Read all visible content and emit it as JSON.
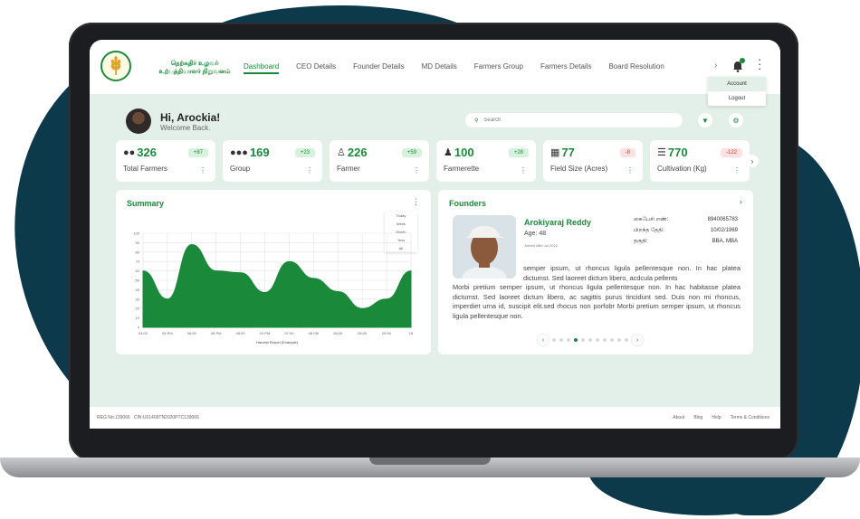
{
  "brand": {
    "line1": "நெற்கதிர் உழவர்",
    "line2": "உற்பத்தியாளர் நிறுவனம்"
  },
  "nav": {
    "items": [
      "Dashboard",
      "CEO Details",
      "Founder Details",
      "MD Details",
      "Farmers Group",
      "Farmers Details",
      "Board Resolution"
    ],
    "more": "›"
  },
  "menu": {
    "items": [
      "Account",
      "Logout"
    ]
  },
  "greeting": {
    "hi": "Hi, Arockia!",
    "welcome": "Welcome Back."
  },
  "search": {
    "placeholder": "Search"
  },
  "stats": [
    {
      "value": "326",
      "badge": "+87",
      "label": "Total Farmers",
      "trend": "up",
      "icon": "users-icon"
    },
    {
      "value": "169",
      "badge": "+23",
      "label": "Group",
      "trend": "up",
      "icon": "group-icon"
    },
    {
      "value": "226",
      "badge": "+59",
      "label": "Farmer",
      "trend": "up",
      "icon": "farmer-icon"
    },
    {
      "value": "100",
      "badge": "+28",
      "label": "Farmerette",
      "trend": "up",
      "icon": "farmerette-icon"
    },
    {
      "value": "77",
      "badge": "-8",
      "label": "Field Size (Acres)",
      "trend": "down",
      "icon": "field-icon"
    },
    {
      "value": "770",
      "badge": "-122",
      "label": "Cultivation (Kg)",
      "trend": "down",
      "icon": "cultivation-icon"
    }
  ],
  "summary": {
    "title": "Summary",
    "filter_options": [
      "Today",
      "Week",
      "Month",
      "Year",
      "All"
    ]
  },
  "chart_data": {
    "type": "area",
    "x": [
      "04:00",
      "05 PM",
      "06:00",
      "08 PM",
      "06:00",
      "10 PM",
      "07:00",
      "08 PM",
      "06:00",
      "08:00",
      "09:00",
      "18"
    ],
    "values": [
      60,
      30,
      88,
      60,
      58,
      37,
      70,
      52,
      38,
      20,
      30,
      60
    ],
    "xlabel": "Harvest Report (Example)",
    "ylim": [
      0,
      100
    ],
    "yticks": [
      0,
      10,
      20,
      30,
      40,
      50,
      60,
      70,
      80,
      90,
      100
    ],
    "color": "#1a8a3a",
    "grid": true
  },
  "founders": {
    "title": "Founders",
    "name": "Arokiyaraj Reddy",
    "age": "Age: 48",
    "joined": "Joined 28th Jul 2022",
    "details": [
      {
        "label": "கைபேசி எண்:",
        "value": "8940065783"
      },
      {
        "label": "பிறந்த தேதி:",
        "value": "10/02/1969"
      },
      {
        "label": "தகுதி:",
        "value": "BBA, MBA"
      }
    ],
    "body1": "semper ipsum, ut rhoncus ligula pellentesque non. In hac platea dictumst. Sed laoreet dictum libero, acdcula pellents",
    "body2": "Morbi pretium semper ipsum, ut rhoncus ligula pellentesque non. In hac habitasse platea dictumst. Sed laoreet dictum libero, ac sagittis purus tincidunt sed. Duis non mi rhoncus, imperdiet urna id, suscipit elit.sed rhocus non porfobr Morbi pretium semper ipsum, ut rhoncus ligula pellentesque non.",
    "carousel_pages": 11,
    "carousel_active": 3
  },
  "footer": {
    "reg": "REG No:139066",
    "cin": "CIN:U01409TN2020PTC139066",
    "links": [
      "About",
      "Blog",
      "Help",
      "Terms & Conditions"
    ]
  }
}
